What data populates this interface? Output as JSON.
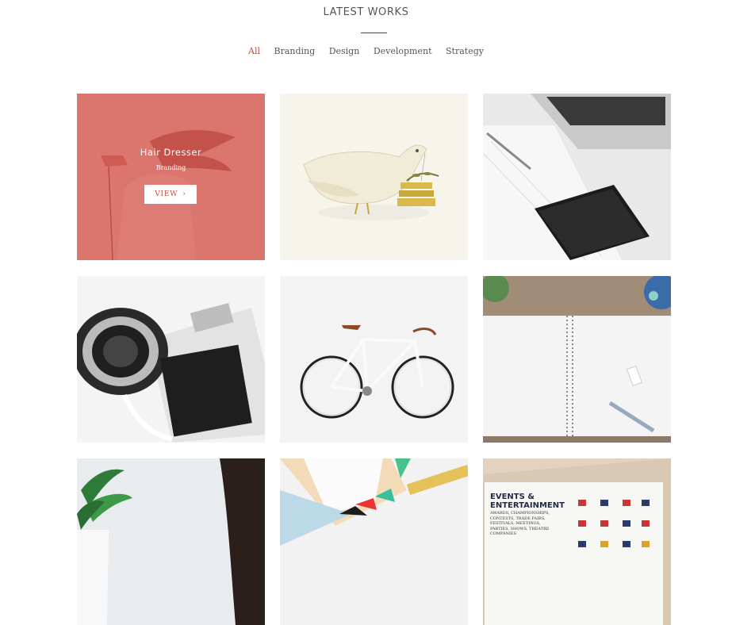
{
  "section": {
    "title": "LATEST WORKS"
  },
  "filters": [
    {
      "label": "All",
      "active": true
    },
    {
      "label": "Branding",
      "active": false
    },
    {
      "label": "Design",
      "active": false
    },
    {
      "label": "Development",
      "active": false
    },
    {
      "label": "Strategy",
      "active": false
    }
  ],
  "colors": {
    "accent": "#c94a3d",
    "overlay": "#d66258"
  },
  "portfolio": {
    "hovered_item": {
      "title": "Hair Dresser",
      "category": "Branding",
      "view_label": "VIEW",
      "view_icon": "chevron-right-icon"
    },
    "events_card": {
      "title_line1": "EVENTS &",
      "title_line2": "ENTERTAINMENT",
      "subtitle": "AWARDS, CHAMPIONSHIPS, CONTESTS, TRADE FAIRS, FESTIVALS, MEETINGS, PARTIES, SHOWS, THEATRE COMPANIES"
    }
  }
}
